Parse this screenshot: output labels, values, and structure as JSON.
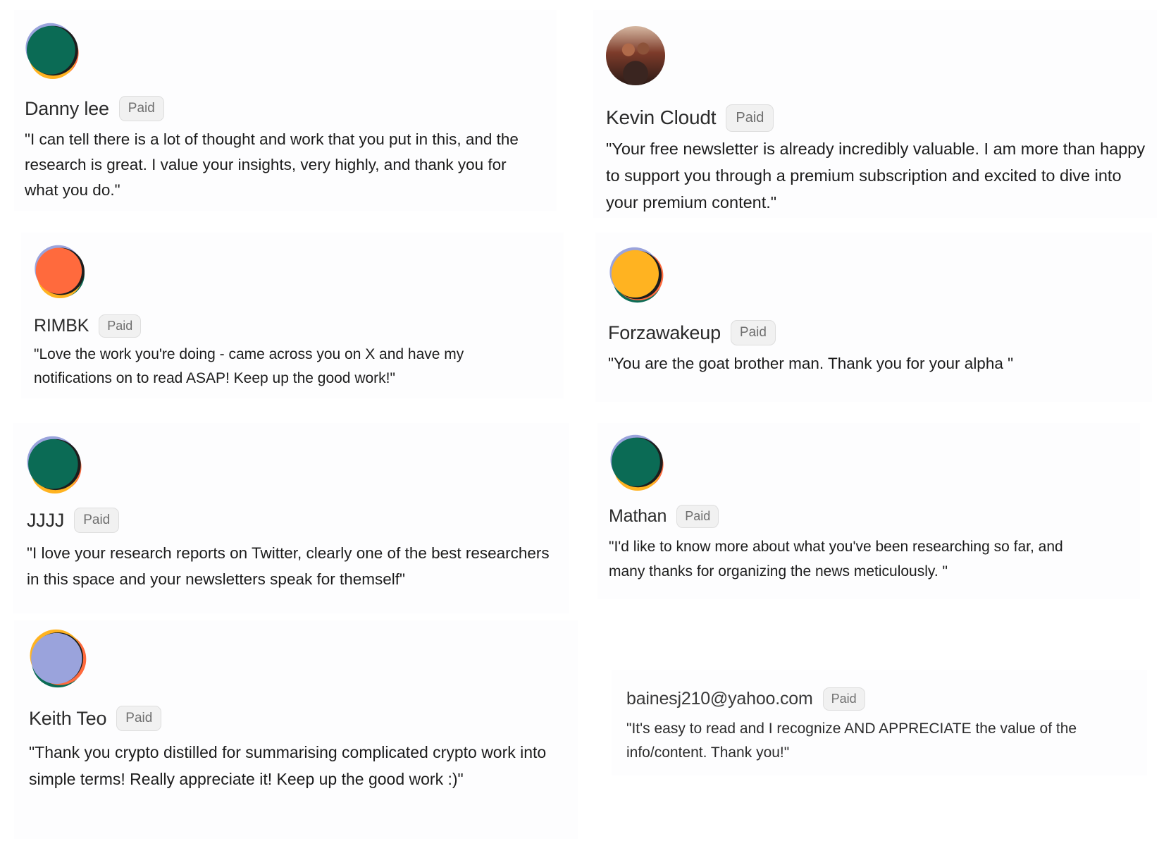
{
  "badge_label": "Paid",
  "testimonials": [
    {
      "name": "Danny lee",
      "quote": "\"I can tell there is a lot of thought and work that you put in this, and the research is great. I value your insights, very highly, and thank you for what you do.\"",
      "avatar": "green-orange-logo-icon"
    },
    {
      "name": "Kevin Cloudt",
      "quote": "\"Your free newsletter is already incredibly valuable. I am more than happy to support you through a premium subscription and excited to dive into your premium content.\"",
      "avatar": "user-photo"
    },
    {
      "name": "RIMBK",
      "quote": "\"Love the work you're doing - came across you on X and have my notifications on to read ASAP! Keep up the good work!\"",
      "avatar": "orange-green-logo-icon"
    },
    {
      "name": "Forzawakeup",
      "quote": "\"You are the goat brother man. Thank you for your alpha \"",
      "avatar": "yellow-green-logo-icon"
    },
    {
      "name": "JJJJ",
      "quote": "\"I love your research reports on Twitter, clearly one of the best researchers in this space and your newsletters speak for themself\"",
      "avatar": "green-orange-logo-icon"
    },
    {
      "name": "Mathan",
      "quote": "\"I'd like to know more about what you've been researching so far, and many thanks for organizing the news meticulously. \"",
      "avatar": "green-orange-logo-icon"
    },
    {
      "name": "Keith Teo",
      "quote": "\"Thank you crypto distilled for summarising complicated crypto work into simple terms! Really appreciate it! Keep up the good work :)\"",
      "avatar": "lavender-orange-logo-icon"
    },
    {
      "name": "bainesj210@yahoo.com",
      "quote": "\"It's easy to read and I recognize AND APPRECIATE the value of the info/content. Thank you!\"",
      "avatar": ""
    }
  ],
  "colors": {
    "green": "#0b6b55",
    "orange": "#ff6a3d",
    "yellow": "#ffb321",
    "lavender": "#9aa3dc",
    "dark": "#1d1d1d"
  }
}
